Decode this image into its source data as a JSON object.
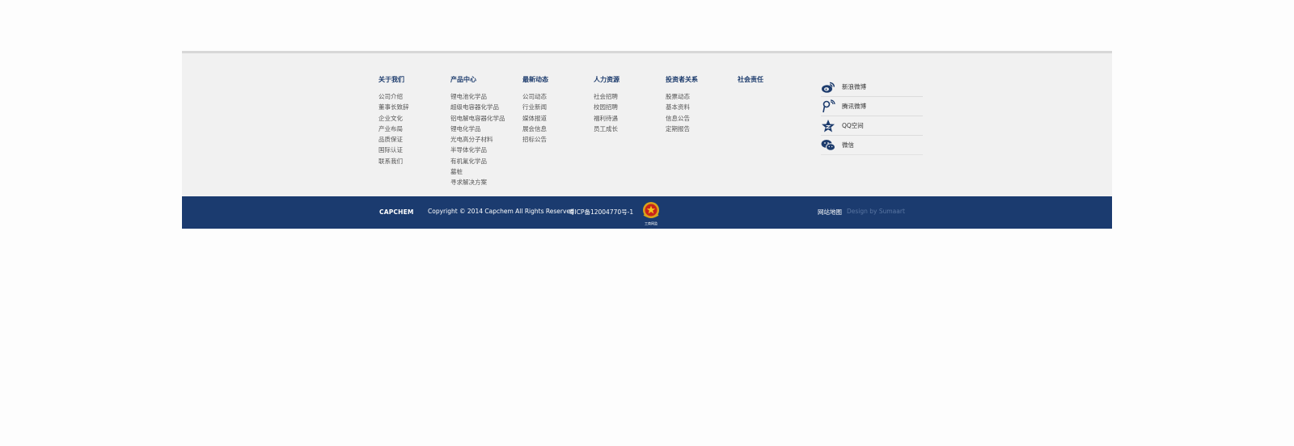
{
  "colors": {
    "footer_bg": "#f1f1f1",
    "bottom_bar": "#1b3b6f",
    "title": "#1d3c6d",
    "link": "#555555",
    "muted": "#5a76a2"
  },
  "nav": [
    {
      "title": "关于我们",
      "links": [
        "公司介绍",
        "董事长致辞",
        "企业文化",
        "产业布局",
        "品质保证",
        "国际认证",
        "联系我们"
      ]
    },
    {
      "title": "产品中心",
      "links": [
        "锂电池化学品",
        "超级电容器化学品",
        "铝电解电容器化学品",
        "锂电化学品",
        "光电高分子材料",
        "半导体化学品",
        "有机氟化学品",
        "墓桩",
        "寻求解决方案"
      ]
    },
    {
      "title": "最新动态",
      "links": [
        "公司动态",
        "行业新闻",
        "媒体报道",
        "展会信息",
        "招标公告"
      ]
    },
    {
      "title": "人力资源",
      "links": [
        "社会招聘",
        "校园招聘",
        "福利待遇",
        "员工成长"
      ]
    },
    {
      "title": "投资者关系",
      "links": [
        "股票动态",
        "基本资料",
        "信息公告",
        "定期报告"
      ]
    },
    {
      "title": "社会责任",
      "links": []
    }
  ],
  "social": [
    {
      "label": "新浪微博",
      "icon": "weibo-icon"
    },
    {
      "label": "腾讯微博",
      "icon": "tencent-weibo-icon"
    },
    {
      "label": "QQ空间",
      "icon": "qzone-icon"
    },
    {
      "label": "微信",
      "icon": "wechat-icon"
    }
  ],
  "bottom": {
    "logo": "CAPCHEM",
    "copyright": "Copyright © 2014 Capchem All Rights Reserved",
    "icp": "粤ICP备12004770号-1",
    "badge_text": "工商网监",
    "sitemap": "网站地图",
    "design": "Design by Sumaart"
  }
}
